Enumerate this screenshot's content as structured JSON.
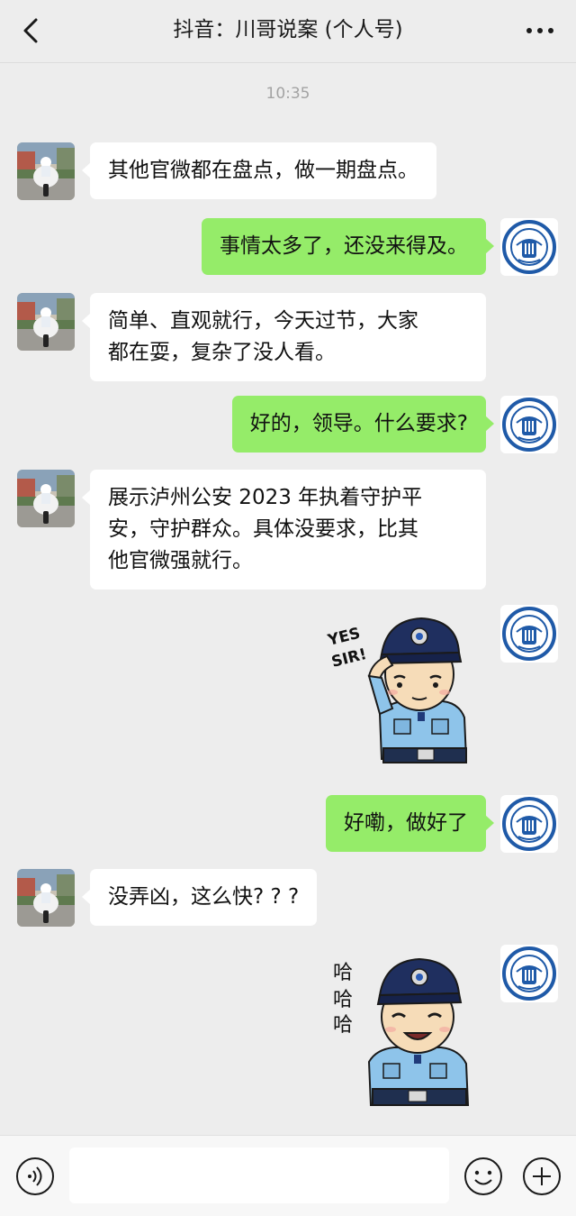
{
  "header": {
    "title": "抖音：川哥说案 (个人号)",
    "back_icon": "chevron-left-icon",
    "more_icon": "ellipsis-icon"
  },
  "timestamp": "10:35",
  "colors": {
    "background": "#ededed",
    "incoming_bubble": "#ffffff",
    "outgoing_bubble": "#95ec69",
    "police_navy": "#1f3a7a",
    "police_badge_blue": "#2a5bb5"
  },
  "messages": [
    {
      "side": "incoming",
      "type": "text",
      "text": "其他官微都在盘点，做一期盘点。"
    },
    {
      "side": "outgoing",
      "type": "text",
      "text": "事情太多了，还没来得及。"
    },
    {
      "side": "incoming",
      "type": "text",
      "text": "简单、直观就行，今天过节，大家\n都在耍，复杂了没人看。"
    },
    {
      "side": "outgoing",
      "type": "text",
      "text": "好的，领导。什么要求?"
    },
    {
      "side": "incoming",
      "type": "text",
      "text": "展示泸州公安 2023 年执着守护平\n安，守护群众。具体没要求，比其\n他官微强就行。"
    },
    {
      "side": "outgoing",
      "type": "sticker",
      "sticker": "saluting-police-officer",
      "caption": "YES\nSIR!"
    },
    {
      "side": "outgoing",
      "type": "text",
      "text": "好嘞，做好了"
    },
    {
      "side": "incoming",
      "type": "text",
      "text": "没弄凶，这么快? ? ?"
    },
    {
      "side": "outgoing",
      "type": "sticker",
      "sticker": "laughing-police-officer",
      "caption": "哈\n哈\n哈"
    }
  ],
  "avatars": {
    "incoming": "motorcycle-police-avatar",
    "outgoing": "police-emblem-avatar"
  },
  "composer": {
    "voice_icon": "voice-icon",
    "input_value": "",
    "emoji_icon": "emoji-icon",
    "plus_icon": "plus-icon"
  }
}
